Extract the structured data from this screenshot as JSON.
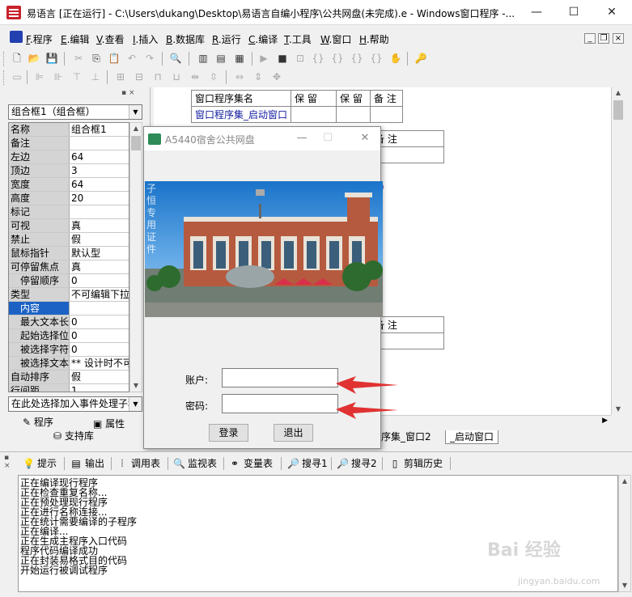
{
  "window": {
    "title": "易语言 [正在运行] - C:\\Users\\dukang\\Desktop\\易语言自编小程序\\公共网盘(未完成).e - Windows窗口程序 -...",
    "min_label": "—",
    "max_label": "☐",
    "close_label": "✕"
  },
  "menu": [
    {
      "key": "F",
      "label": ".程序"
    },
    {
      "key": "E",
      "label": ".编辑"
    },
    {
      "key": "V",
      "label": ".查看"
    },
    {
      "key": "I",
      "label": ".插入"
    },
    {
      "key": "B",
      "label": ".数据库"
    },
    {
      "key": "R",
      "label": ".运行"
    },
    {
      "key": "C",
      "label": ".编译"
    },
    {
      "key": "T",
      "label": ".工具"
    },
    {
      "key": "W",
      "label": ".窗口"
    },
    {
      "key": "H",
      "label": ".帮助"
    }
  ],
  "left_panel": {
    "component_combo": "组合框1（组合框）",
    "properties": [
      {
        "name": "名称",
        "value": "组合框1"
      },
      {
        "name": "备注",
        "value": ""
      },
      {
        "name": "左边",
        "value": "64"
      },
      {
        "name": "顶边",
        "value": "3"
      },
      {
        "name": "宽度",
        "value": "64"
      },
      {
        "name": "高度",
        "value": "20"
      },
      {
        "name": "标记",
        "value": ""
      },
      {
        "name": "可视",
        "value": "真"
      },
      {
        "name": "禁止",
        "value": "假"
      },
      {
        "name": "鼠标指针",
        "value": "默认型"
      },
      {
        "name": "可停留焦点",
        "value": "真"
      },
      {
        "name": "停留顺序",
        "value": "0",
        "indent": true
      },
      {
        "name": "类型",
        "value": "不可编辑下拉"
      },
      {
        "name": "内容",
        "value": "",
        "indent": true,
        "selected": true
      },
      {
        "name": "最大文本长",
        "value": "0",
        "indent": true
      },
      {
        "name": "起始选择位",
        "value": "0",
        "indent": true
      },
      {
        "name": "被选择字符",
        "value": "0",
        "indent": true
      },
      {
        "name": "被选择文本",
        "value": "** 设计时不可",
        "indent": true
      },
      {
        "name": "自动排序",
        "value": "假"
      },
      {
        "name": "行间距",
        "value": "1"
      }
    ],
    "event_combo": "在此处选择加入事件处理子程",
    "tab_program": "程序",
    "tab_property": "属性",
    "tab_support": "支持库"
  },
  "code": {
    "table1_headers": [
      "窗口程序集名",
      "保 留",
      "保 留",
      "备 注"
    ],
    "table1_row": [
      "窗口程序集_启动窗口",
      "",
      "",
      ""
    ],
    "table2_header": "备 注",
    "table3_header": "备 注",
    "paren_fragment": ")"
  },
  "doc_tabs": {
    "tab1": "程序集_窗口2",
    "tab2": "_启动窗口"
  },
  "dialog": {
    "title": "A5440宿舍公共网盘",
    "photo_caption": "子恒专用证件",
    "account_label": "账户:",
    "password_label": "密码:",
    "login_button": "登录",
    "exit_button": "退出"
  },
  "output_tabs": [
    "提示",
    "输出",
    "调用表",
    "监视表",
    "变量表",
    "搜寻1",
    "搜寻2",
    "剪辑历史"
  ],
  "output_lines": [
    "正在编译现行程序",
    "正在检查重复名称...",
    "正在预处理现行程序",
    "正在进行名称连接...",
    "正在统计需要编译的子程序",
    "正在编译...",
    "正在生成主程序入口代码",
    "程序代码编译成功",
    "正在封装易格式目的代码",
    "开始运行被调试程序"
  ],
  "watermark": {
    "text": "Bai 经验",
    "url": "jingyan.baidu.com"
  },
  "colors": {
    "accent_red": "#e03232",
    "selection_blue": "#1c62c4",
    "code_blue": "#1620a0"
  }
}
